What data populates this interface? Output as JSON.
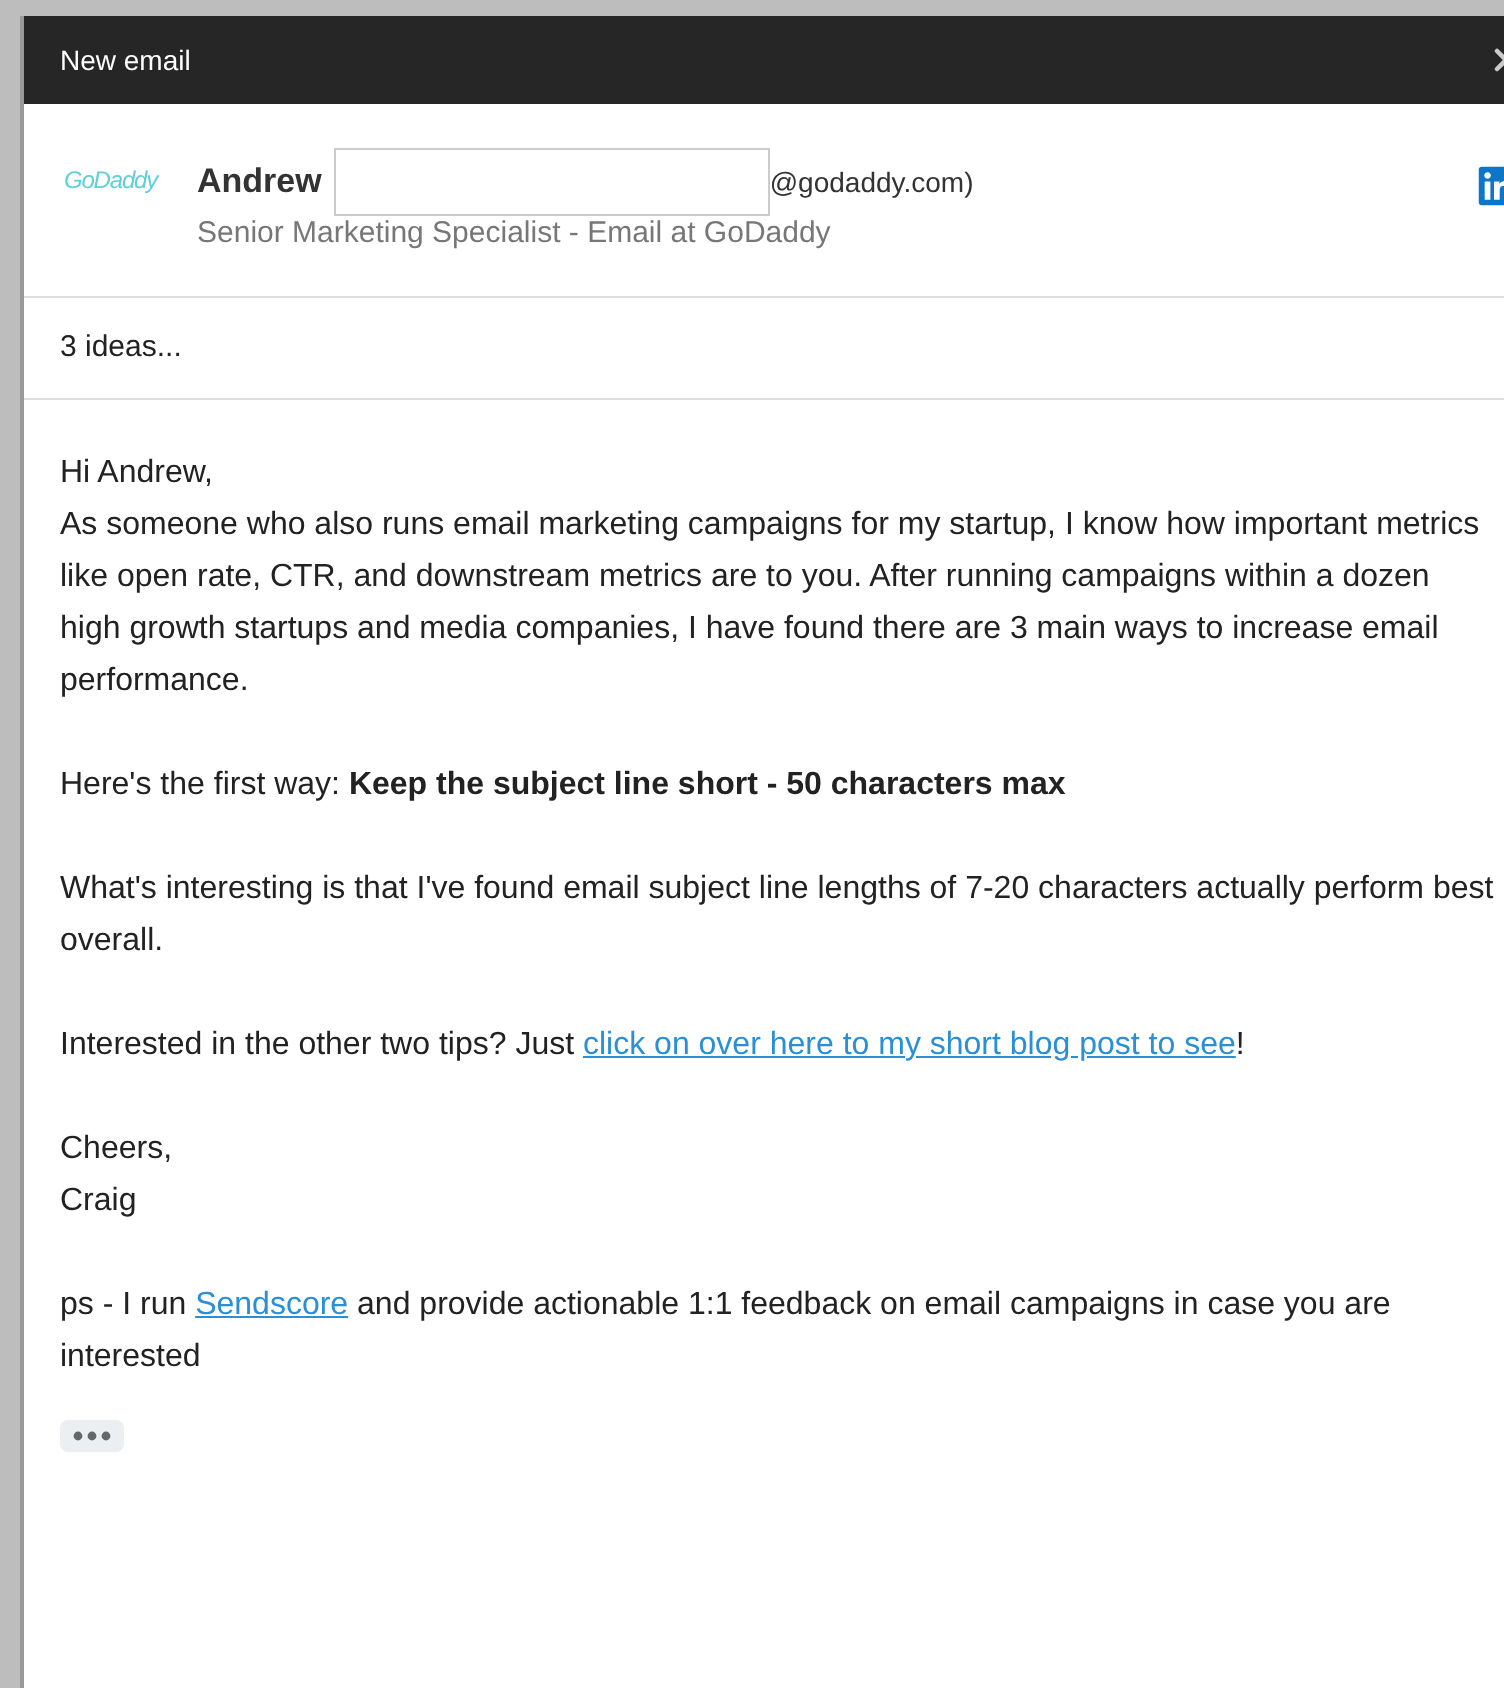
{
  "window": {
    "title": "New email"
  },
  "contact": {
    "logo_text": "GoDaddy",
    "first_name": "Andrew",
    "email_suffix": "@godaddy.com)",
    "job_title": "Senior Marketing Specialist - Email at GoDaddy"
  },
  "subject": "3 ideas...",
  "body": [
    {
      "lines": [
        [
          {
            "kind": "text",
            "text": "Hi Andrew,"
          }
        ],
        [
          {
            "kind": "text",
            "text": "As someone who also runs email marketing campaigns for my startup, I know how important metrics like open rate, CTR, and downstream metrics are to you. After running campaigns within a dozen high growth startups and media companies, I have found there are 3 main ways to increase email performance."
          }
        ]
      ]
    },
    {
      "lines": [
        [
          {
            "kind": "text",
            "text": "Here's the first way: "
          },
          {
            "kind": "bold",
            "text": "Keep the subject line short - 50 characters max"
          }
        ]
      ]
    },
    {
      "lines": [
        [
          {
            "kind": "text",
            "text": "What's interesting is that I've found email subject line lengths of 7-20 characters actually perform best overall."
          }
        ]
      ]
    },
    {
      "lines": [
        [
          {
            "kind": "text",
            "text": "Interested in the other two tips? Just "
          },
          {
            "kind": "link",
            "text": "click on over here to my short blog post to see"
          },
          {
            "kind": "text",
            "text": "!"
          }
        ]
      ]
    },
    {
      "lines": [
        [
          {
            "kind": "text",
            "text": "Cheers,"
          }
        ],
        [
          {
            "kind": "text",
            "text": "Craig"
          }
        ]
      ]
    },
    {
      "lines": [
        [
          {
            "kind": "text",
            "text": "ps - I run "
          },
          {
            "kind": "link",
            "text": "Sendscore"
          },
          {
            "kind": "text",
            "text": " and provide actionable 1:1 feedback on email campaigns in case you are interested"
          }
        ]
      ]
    }
  ]
}
